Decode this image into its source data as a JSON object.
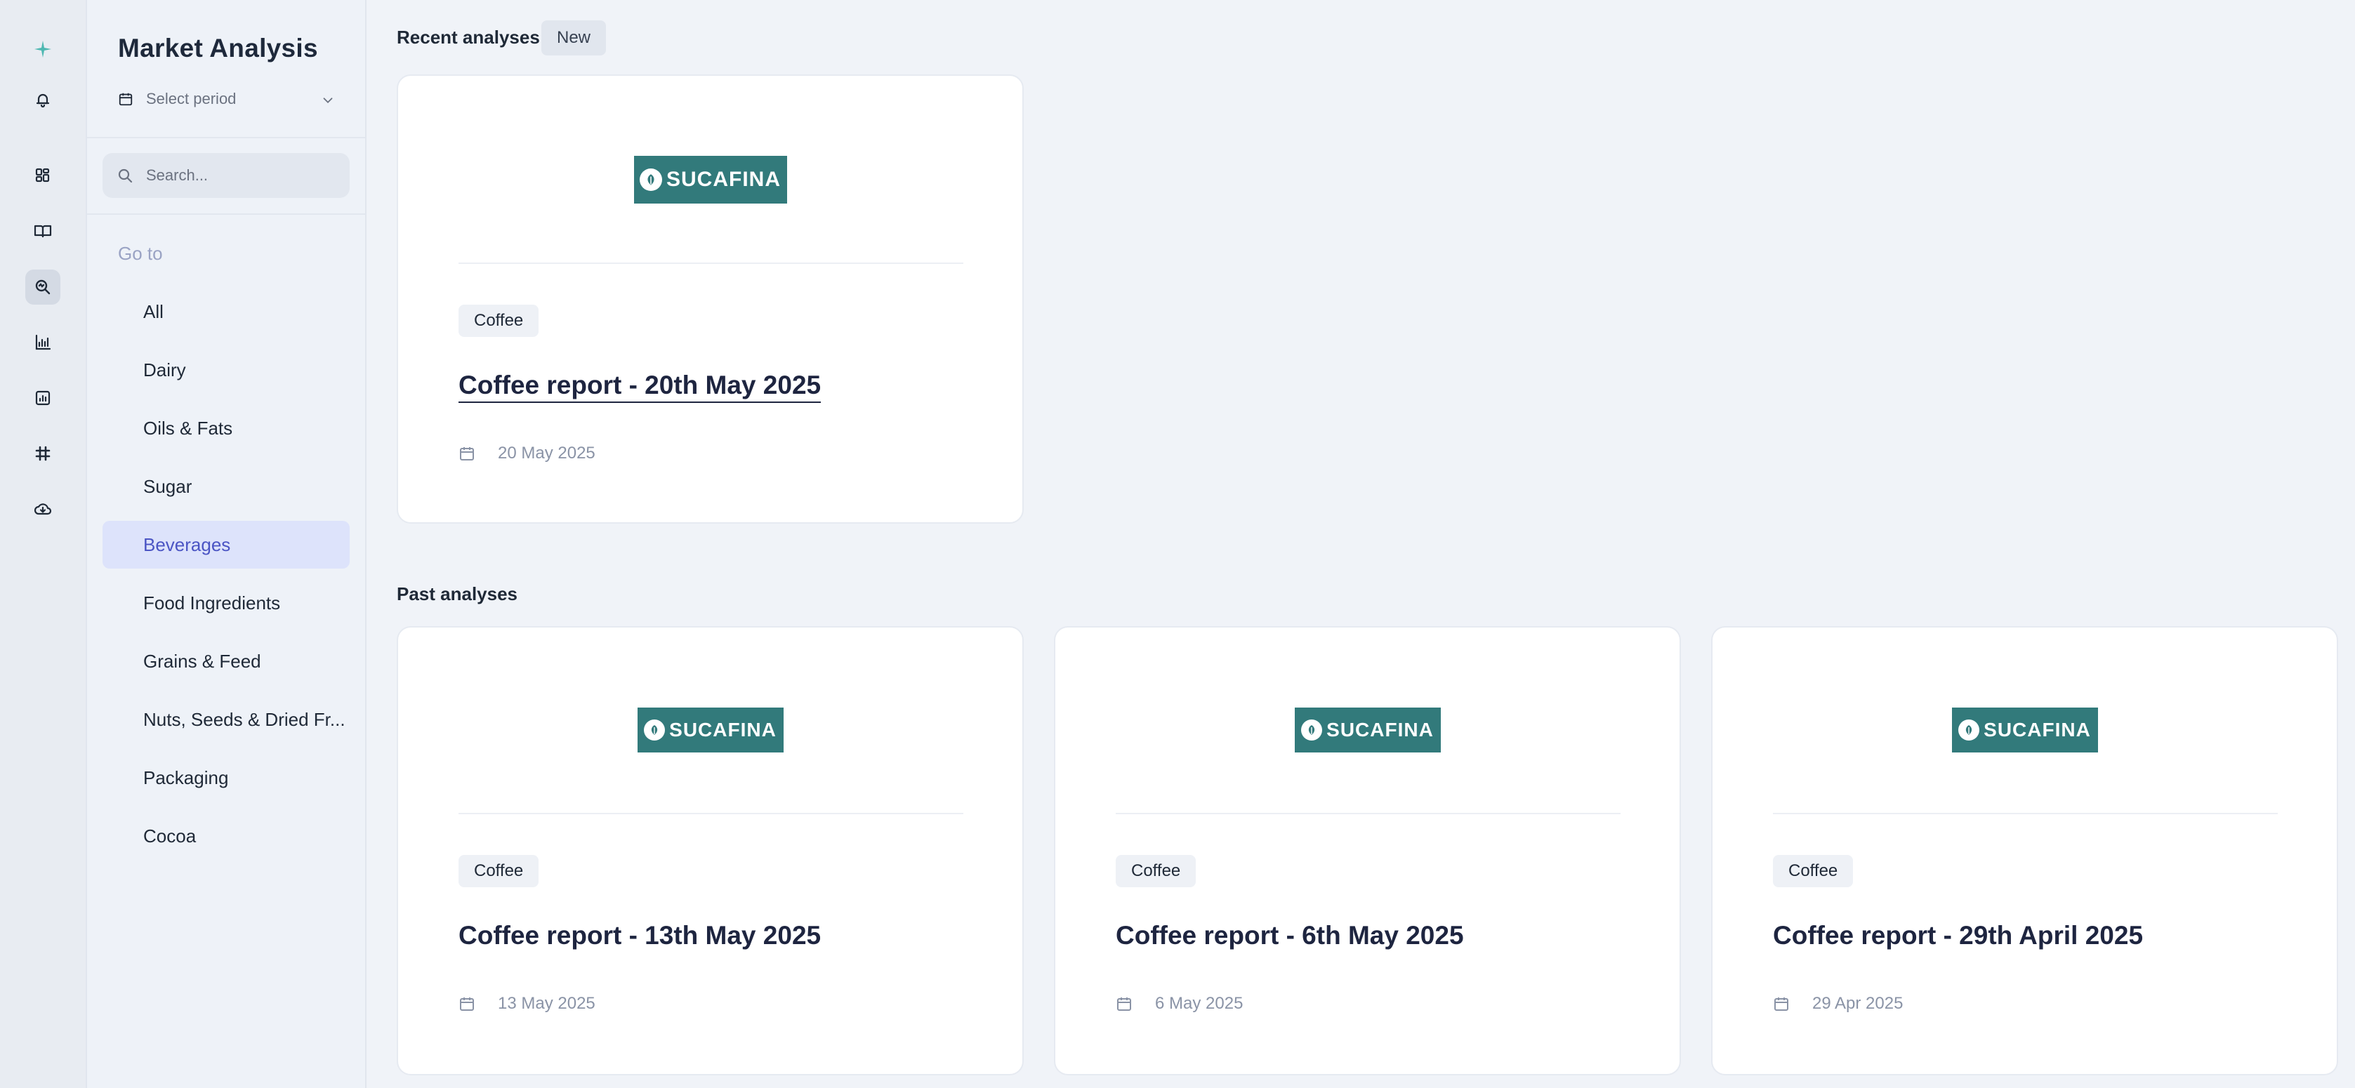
{
  "sidebar": {
    "title": "Market Analysis",
    "period_placeholder": "Select period",
    "search_placeholder": "Search...",
    "goto_label": "Go to",
    "items": [
      {
        "label": "All",
        "active": false
      },
      {
        "label": "Dairy",
        "active": false
      },
      {
        "label": "Oils & Fats",
        "active": false
      },
      {
        "label": "Sugar",
        "active": false
      },
      {
        "label": "Beverages",
        "active": true
      },
      {
        "label": "Food Ingredients",
        "active": false
      },
      {
        "label": "Grains & Feed",
        "active": false
      },
      {
        "label": "Nuts, Seeds & Dried Fr...",
        "active": false
      },
      {
        "label": "Packaging",
        "active": false
      },
      {
        "label": "Cocoa",
        "active": false
      }
    ]
  },
  "rail": {
    "icons": [
      "sparkle-logo-icon",
      "bell-icon",
      "dashboard-icon",
      "book-icon",
      "search-analysis-icon",
      "bar-chart-icon",
      "report-icon",
      "grid-hash-icon",
      "cloud-download-icon"
    ],
    "active": "search-analysis-icon"
  },
  "main": {
    "recent_title": "Recent analyses",
    "new_badge": "New",
    "past_title": "Past analyses",
    "recent": [
      {
        "logo": "SUCAFINA",
        "tag": "Coffee",
        "title": "Coffee report - 20th May 2025",
        "date": "20 May 2025"
      }
    ],
    "past": [
      {
        "logo": "SUCAFINA",
        "tag": "Coffee",
        "title": "Coffee report - 13th May 2025",
        "date": "13 May 2025"
      },
      {
        "logo": "SUCAFINA",
        "tag": "Coffee",
        "title": "Coffee report - 6th May 2025",
        "date": "6 May 2025"
      },
      {
        "logo": "SUCAFINA",
        "tag": "Coffee",
        "title": "Coffee report - 29th April 2025",
        "date": "29 Apr 2025"
      }
    ]
  },
  "colors": {
    "accent": "#4b55c4",
    "active_bg": "#dde3fb",
    "logo_bg": "#327a7b",
    "rail_logo": "#4fb8b2"
  }
}
